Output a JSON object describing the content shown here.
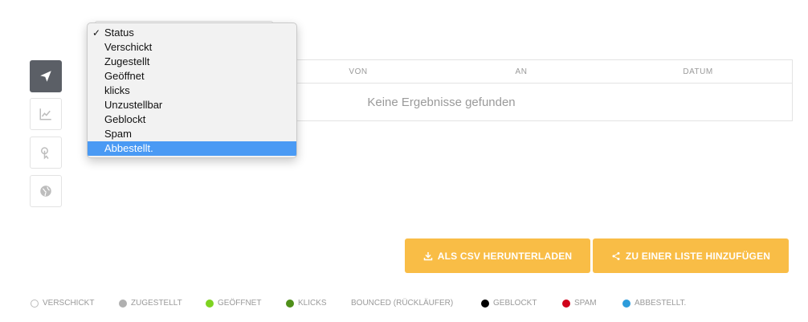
{
  "table": {
    "columns": [
      "VON",
      "AN",
      "DATUM"
    ],
    "empty_text": "Keine Ergebnisse gefunden"
  },
  "sidebar": {
    "items": [
      {
        "icon": "paper-plane-icon",
        "active": true
      },
      {
        "icon": "chart-line-icon",
        "active": false
      },
      {
        "icon": "click-pointer-icon",
        "active": false
      },
      {
        "icon": "globe-icon",
        "active": false
      }
    ]
  },
  "status_dropdown": {
    "selected": "Status",
    "highlighted": "Abbestellt.",
    "options": [
      "Status",
      "Verschickt",
      "Zugestellt",
      "Geöffnet",
      "klicks",
      "Unzustellbar",
      "Geblockt",
      "Spam",
      "Abbestellt."
    ]
  },
  "actions": {
    "csv_label": "ALS CSV HERUNTERLADEN",
    "list_label": "ZU EINER LISTE HINZUFÜGEN",
    "button_color": "#f9bd46"
  },
  "legend": [
    {
      "label": "VERSCHICKT",
      "color": "#ffffff",
      "outlined": true
    },
    {
      "label": "ZUGESTELLT",
      "color": "#b0b0b0"
    },
    {
      "label": "GEÖFFNET",
      "color": "#7ed321"
    },
    {
      "label": "KLICKS",
      "color": "#4f8f1a"
    },
    {
      "label": "BOUNCED (RÜCKLÄUFER)",
      "color": null
    },
    {
      "label": "GEBLOCKT",
      "color": "#000000"
    },
    {
      "label": "SPAM",
      "color": "#d0021b"
    },
    {
      "label": "ABBESTELLT.",
      "color": "#2d9cdb"
    }
  ]
}
